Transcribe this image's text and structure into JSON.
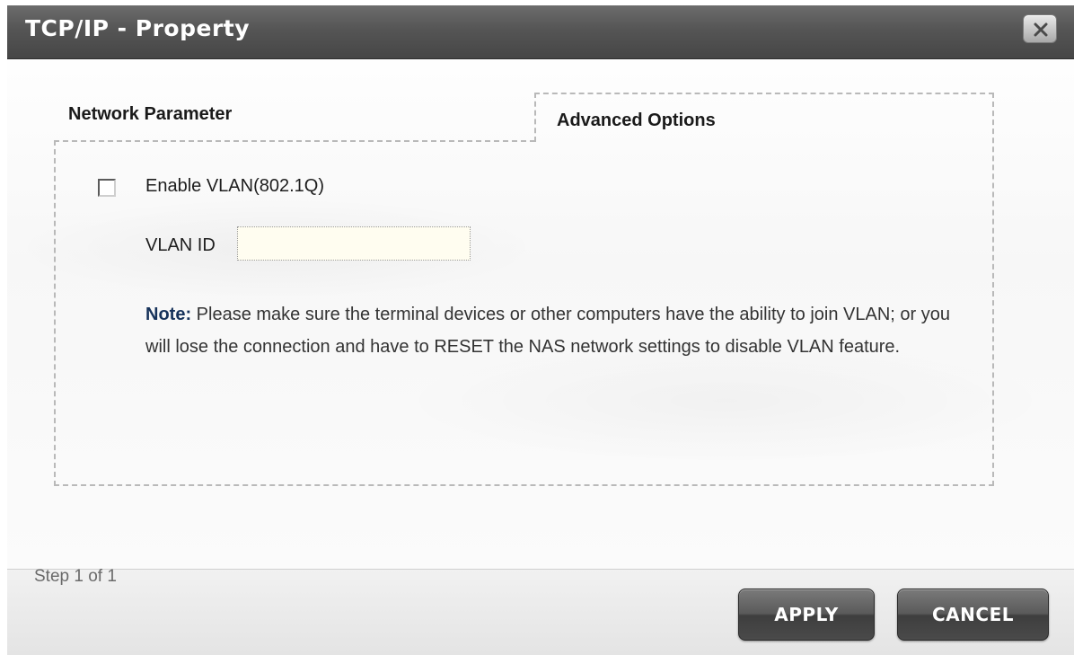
{
  "dialog": {
    "title": "TCP/IP - Property",
    "close_icon": "close-x-icon"
  },
  "tabs": [
    {
      "label": "Network Parameter",
      "active": false
    },
    {
      "label": "Advanced Options",
      "active": true
    }
  ],
  "vlan": {
    "enable_label": "Enable VLAN(802.1Q)",
    "enabled": false,
    "id_label": "VLAN ID",
    "id_value": "",
    "id_placeholder": ""
  },
  "note": {
    "key": "Note:",
    "text": " Please make sure the terminal devices or other computers have the ability to join VLAN; or you will lose the connection and have to RESET the NAS network settings to disable VLAN feature."
  },
  "footer": {
    "step": "Step 1 of 1",
    "apply_label": "APPLY",
    "cancel_label": "CANCEL"
  },
  "colors": {
    "titlebar": "#555555",
    "note_key": "#16325a",
    "button": "#4a4a4a"
  }
}
